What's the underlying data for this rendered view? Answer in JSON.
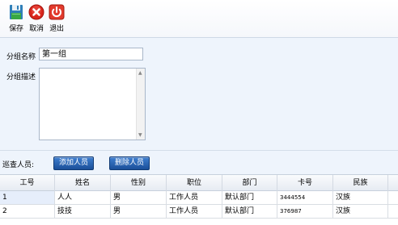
{
  "toolbar": {
    "save_label": "保存",
    "cancel_label": "取消",
    "exit_label": "退出"
  },
  "form": {
    "name_label": "分组名称",
    "name_value": "第一组",
    "desc_label": "分组描述",
    "desc_value": ""
  },
  "patrol": {
    "label": "巡查人员:",
    "add_button": "添加人员",
    "delete_button": "删除人员"
  },
  "table": {
    "headers": [
      "工号",
      "姓名",
      "性别",
      "职位",
      "部门",
      "卡号",
      "民族"
    ],
    "rows": [
      [
        "1",
        "人人",
        "男",
        "工作人员",
        "默认部门",
        "3444554",
        "汉族"
      ],
      [
        "2",
        "技技",
        "男",
        "工作人员",
        "默认部门",
        "376987",
        "汉族"
      ]
    ]
  },
  "colors": {
    "save_icon": "#2f8b3a",
    "cancel_icon": "#d9261c",
    "exit_icon": "#e23a2c",
    "button_blue": "#1f5aa6",
    "panel_bg": "#eef4fc"
  },
  "icons": {
    "save": "floppy-disk-icon",
    "cancel": "cancel-x-icon",
    "exit": "power-icon"
  }
}
